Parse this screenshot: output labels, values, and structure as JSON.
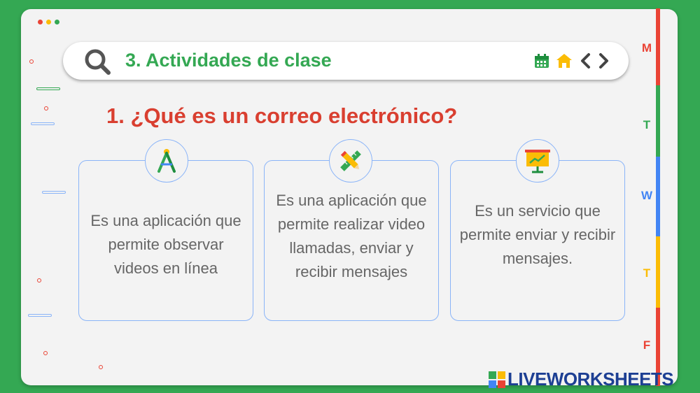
{
  "window": {
    "dots": [
      "#ea4335",
      "#fbbc05",
      "#34a853"
    ]
  },
  "header": {
    "title": "3. Actividades de clase",
    "icons": [
      "search-icon",
      "calendar-icon",
      "home-icon",
      "chevron-left-icon",
      "chevron-right-icon"
    ]
  },
  "question": "1. ¿Qué es un correo electrónico?",
  "options": [
    {
      "text": "Es una aplicación que permite observar videos en línea",
      "icon": "drafting-compass-icon"
    },
    {
      "text": "Es una aplicación que permite realizar video llamadas, enviar y recibir mensajes",
      "icon": "pencil-ruler-icon"
    },
    {
      "text": "Es un servicio que permite enviar y recibir mensajes.",
      "icon": "presentation-board-icon"
    }
  ],
  "weekdays": [
    {
      "letter": "M",
      "color": "#ea4335"
    },
    {
      "letter": "T",
      "color": "#34a853"
    },
    {
      "letter": "W",
      "color": "#4285f4"
    },
    {
      "letter": "T",
      "color": "#fbbc05"
    },
    {
      "letter": "F",
      "color": "#ea4335"
    }
  ],
  "brand": {
    "name": "LIVEWORKSHEETS"
  }
}
